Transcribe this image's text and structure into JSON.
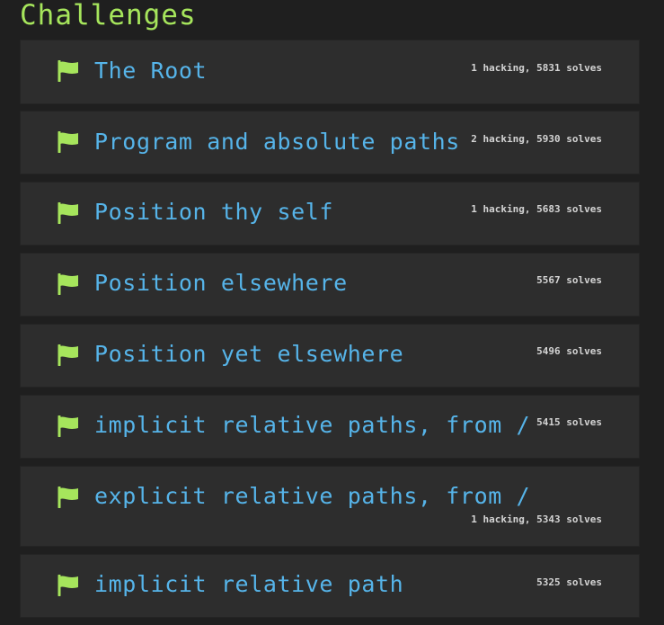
{
  "page": {
    "title": "Challenges"
  },
  "challenges": [
    {
      "name": "The Root",
      "stats": "1 hacking, 5831 solves"
    },
    {
      "name": "Program and absolute paths",
      "stats": "2 hacking, 5930 solves"
    },
    {
      "name": "Position thy self",
      "stats": "1 hacking, 5683 solves"
    },
    {
      "name": "Position elsewhere",
      "stats": "5567 solves"
    },
    {
      "name": "Position yet elsewhere",
      "stats": "5496 solves"
    },
    {
      "name": "implicit relative paths, from /",
      "stats": "5415 solves"
    },
    {
      "name": "explicit relative paths, from /",
      "stats": "1 hacking, 5343 solves"
    },
    {
      "name": "implicit relative path",
      "stats": "5325 solves"
    }
  ],
  "icons": {
    "challenge_icon": "flag-icon"
  },
  "colors": {
    "background": "#1f1f1f",
    "card": "#2d2d2d",
    "title": "#a6e55c",
    "flag": "#a6e55c",
    "challenge_name": "#56b4e9",
    "stats": "#d4d4d4"
  }
}
